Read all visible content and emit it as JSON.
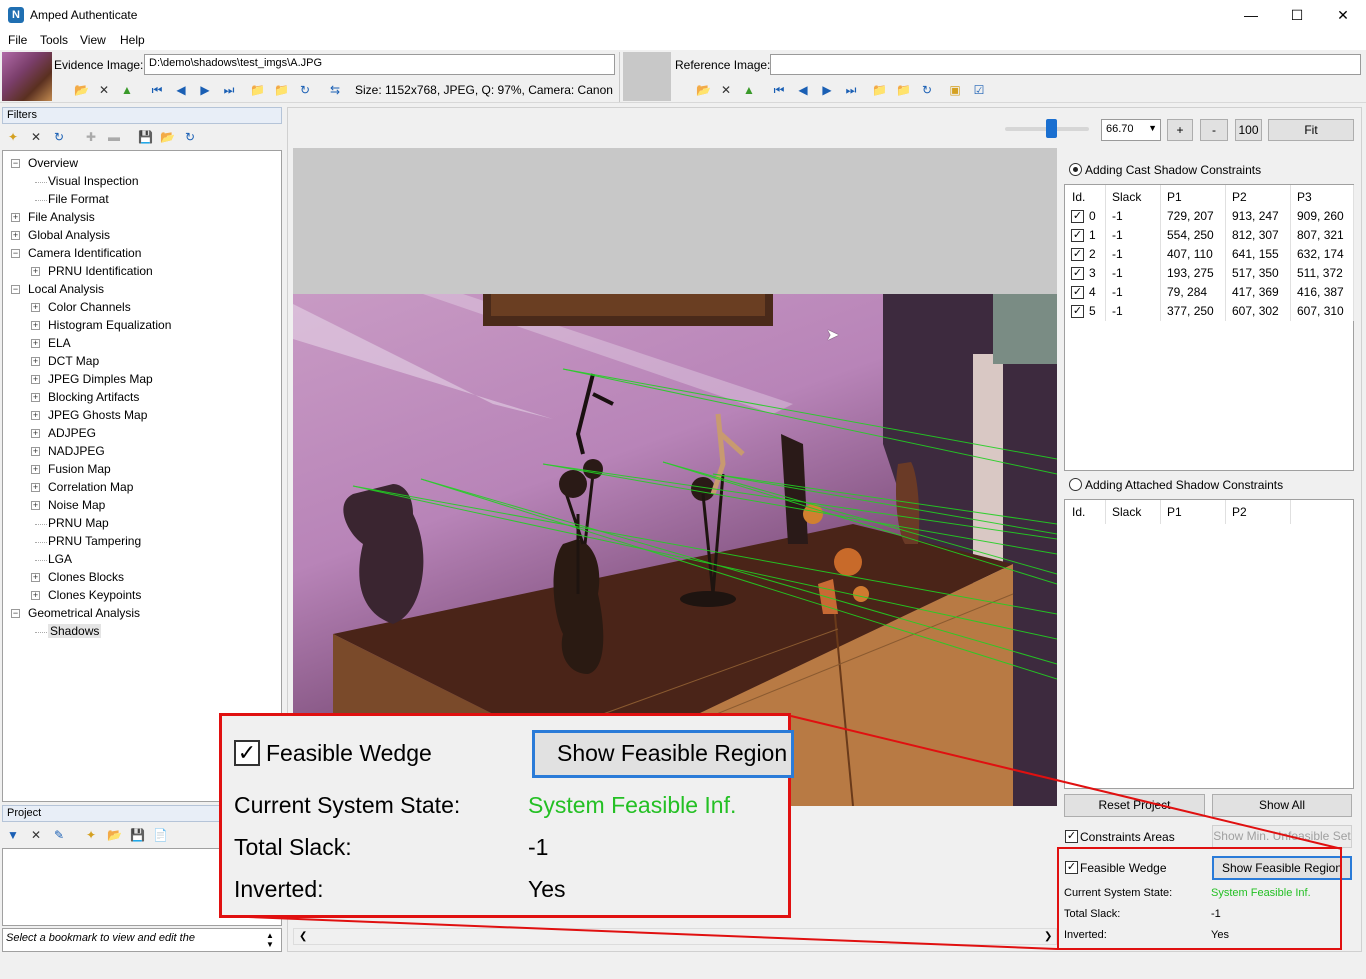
{
  "window": {
    "title": "Amped Authenticate",
    "logo": "N"
  },
  "menu": [
    "File",
    "Tools",
    "View",
    "Help"
  ],
  "evidence": {
    "label": "Evidence Image:",
    "path": "D:\\demo\\shadows\\test_imgs\\A.JPG",
    "info": "Size: 1152x768, JPEG, Q: 97%, Camera: Canon"
  },
  "reference": {
    "label": "Reference Image:",
    "path": ""
  },
  "filters": {
    "title": "Filters",
    "tree": [
      {
        "label": "Overview",
        "level": 0,
        "expander": "-"
      },
      {
        "label": "Visual Inspection",
        "level": 1,
        "expander": ""
      },
      {
        "label": "File Format",
        "level": 1,
        "expander": ""
      },
      {
        "label": "File Analysis",
        "level": 0,
        "expander": "+"
      },
      {
        "label": "Global Analysis",
        "level": 0,
        "expander": "+"
      },
      {
        "label": "Camera Identification",
        "level": 0,
        "expander": "-"
      },
      {
        "label": "PRNU Identification",
        "level": 1,
        "expander": "+"
      },
      {
        "label": "Local Analysis",
        "level": 0,
        "expander": "-"
      },
      {
        "label": "Color Channels",
        "level": 1,
        "expander": "+"
      },
      {
        "label": "Histogram Equalization",
        "level": 1,
        "expander": "+"
      },
      {
        "label": "ELA",
        "level": 1,
        "expander": "+"
      },
      {
        "label": "DCT Map",
        "level": 1,
        "expander": "+"
      },
      {
        "label": "JPEG Dimples Map",
        "level": 1,
        "expander": "+"
      },
      {
        "label": "Blocking Artifacts",
        "level": 1,
        "expander": "+"
      },
      {
        "label": "JPEG Ghosts Map",
        "level": 1,
        "expander": "+"
      },
      {
        "label": "ADJPEG",
        "level": 1,
        "expander": "+"
      },
      {
        "label": "NADJPEG",
        "level": 1,
        "expander": "+"
      },
      {
        "label": "Fusion Map",
        "level": 1,
        "expander": "+"
      },
      {
        "label": "Correlation Map",
        "level": 1,
        "expander": "+"
      },
      {
        "label": "Noise Map",
        "level": 1,
        "expander": "+"
      },
      {
        "label": "PRNU Map",
        "level": 1,
        "expander": ""
      },
      {
        "label": "PRNU Tampering",
        "level": 1,
        "expander": ""
      },
      {
        "label": "LGA",
        "level": 1,
        "expander": ""
      },
      {
        "label": "Clones Blocks",
        "level": 1,
        "expander": "+"
      },
      {
        "label": "Clones Keypoints",
        "level": 1,
        "expander": "+"
      },
      {
        "label": "Geometrical Analysis",
        "level": 0,
        "expander": "-"
      },
      {
        "label": "Shadows",
        "level": 1,
        "expander": "",
        "selected": true
      }
    ]
  },
  "project": {
    "title": "Project",
    "bookmark_hint": "Select a bookmark to view and edit the"
  },
  "zoom": {
    "value": "66.70",
    "plus": "+",
    "minus": "-",
    "hundred": "100",
    "fit": "Fit",
    "slider_fraction": 0.55
  },
  "cast": {
    "radio_label": "Adding Cast Shadow Constraints",
    "selected": true,
    "headers": [
      "Id.",
      "Slack",
      "P1",
      "P2",
      "P3"
    ],
    "rows": [
      {
        "id": "0",
        "slack": "-1",
        "p1": "729, 207",
        "p2": "913, 247",
        "p3": "909, 260",
        "checked": true
      },
      {
        "id": "1",
        "slack": "-1",
        "p1": "554, 250",
        "p2": "812, 307",
        "p3": "807, 321",
        "checked": true
      },
      {
        "id": "2",
        "slack": "-1",
        "p1": "407, 110",
        "p2": "641, 155",
        "p3": "632, 174",
        "checked": true
      },
      {
        "id": "3",
        "slack": "-1",
        "p1": "193, 275",
        "p2": "517, 350",
        "p3": "511, 372",
        "checked": true
      },
      {
        "id": "4",
        "slack": "-1",
        "p1": "79, 284",
        "p2": "417, 369",
        "p3": "416, 387",
        "checked": true
      },
      {
        "id": "5",
        "slack": "-1",
        "p1": "377, 250",
        "p2": "607, 302",
        "p3": "607, 310",
        "checked": true
      }
    ]
  },
  "attached": {
    "radio_label": "Adding Attached Shadow Constraints",
    "selected": false,
    "headers": [
      "Id.",
      "Slack",
      "P1",
      "P2"
    ]
  },
  "buttons": {
    "reset_project": "Reset Project",
    "show_all": "Show All",
    "show_min": "Show Min. Unfeasible Set",
    "show_feasible": "Show Feasible Region"
  },
  "options": {
    "constraints_areas": "Constraints Areas",
    "feasible_wedge": "Feasible Wedge"
  },
  "state": {
    "current_label": "Current System State:",
    "current_value": "System Feasible Inf.",
    "slack_label": "Total Slack:",
    "slack_value": "-1",
    "inverted_label": "Inverted:",
    "inverted_value": "Yes"
  },
  "colors": {
    "feasible_green": "#24c024",
    "callout_red": "#e01010",
    "accent_blue": "#1f6fb2"
  }
}
